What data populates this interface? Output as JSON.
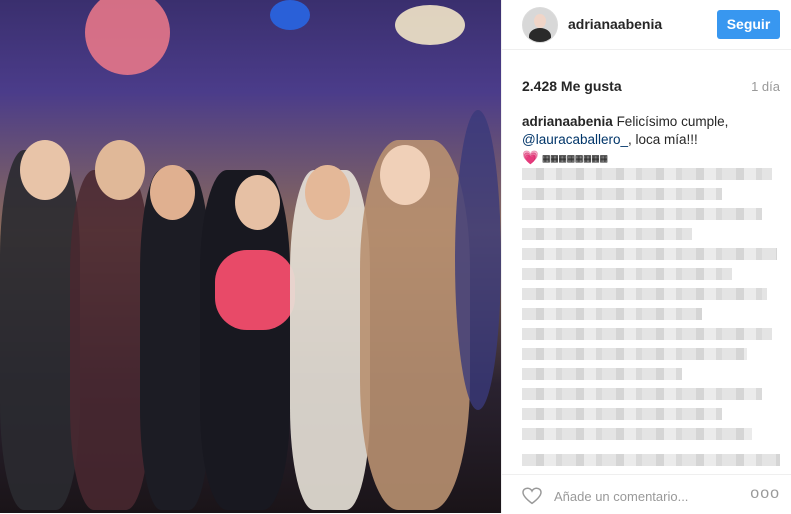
{
  "post": {
    "username": "adrianaabenia",
    "follow_label": "Seguir",
    "likes": "2.428 Me gusta",
    "time": "1 día",
    "caption_user": "adrianaabenia",
    "caption_text_1": "Felicísimo cumple,",
    "caption_mention": "@lauracaballero_",
    "caption_text_2": ", loca mía!!!",
    "caption_emoji": "💗",
    "caption_boxes": "▦▦▦▦▦▦▦▦",
    "comment_placeholder": "Añade un comentario...",
    "more_label": "ooo"
  },
  "colors": {
    "follow": "#3897f0",
    "mention": "#003569",
    "muted": "#999999"
  }
}
